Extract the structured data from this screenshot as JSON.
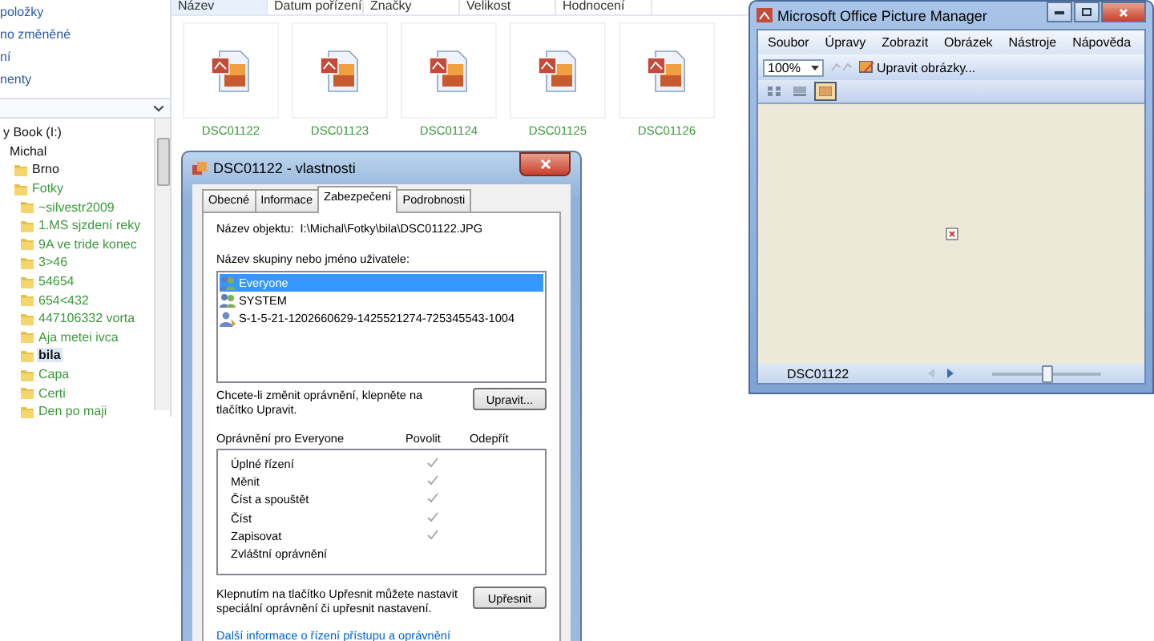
{
  "explorer": {
    "nav_links": [
      "položky",
      "no změněné",
      "ní",
      "nenty"
    ],
    "tree": [
      {
        "label": "y Book (I:)",
        "encrypted": false,
        "selected": false,
        "children": [
          {
            "label": "Michal",
            "encrypted": false,
            "selected": false,
            "children": [
              {
                "label": "Brno",
                "encrypted": false,
                "selected": false
              },
              {
                "label": "Fotky",
                "encrypted": true,
                "selected": false,
                "children": [
                  {
                    "label": "~silvestr2009",
                    "encrypted": true,
                    "selected": false
                  },
                  {
                    "label": "1.MS sjzdení  reky",
                    "encrypted": true,
                    "selected": false
                  },
                  {
                    "label": "9A ve tride konec",
                    "encrypted": true,
                    "selected": false
                  },
                  {
                    "label": "3>46",
                    "encrypted": true,
                    "selected": false
                  },
                  {
                    "label": "54654",
                    "encrypted": true,
                    "selected": false
                  },
                  {
                    "label": "654<432",
                    "encrypted": true,
                    "selected": false
                  },
                  {
                    "label": "447106332 vorta",
                    "encrypted": true,
                    "selected": false
                  },
                  {
                    "label": "Aja metei ivca",
                    "encrypted": true,
                    "selected": false
                  },
                  {
                    "label": "bila",
                    "encrypted": false,
                    "selected": true
                  },
                  {
                    "label": "Capa",
                    "encrypted": true,
                    "selected": false
                  },
                  {
                    "label": "Certi",
                    "encrypted": true,
                    "selected": false
                  },
                  {
                    "label": "Den po maji",
                    "encrypted": true,
                    "selected": false
                  }
                ]
              }
            ]
          }
        ]
      }
    ],
    "columns": [
      {
        "label": "Název",
        "selected": true
      },
      {
        "label": "Datum pořízení",
        "selected": false
      },
      {
        "label": "Značky",
        "selected": false
      },
      {
        "label": "Velikost",
        "selected": false
      },
      {
        "label": "Hodnocení",
        "selected": false
      }
    ],
    "files": [
      {
        "name": "DSC01122",
        "encrypted": true
      },
      {
        "name": "DSC01123",
        "encrypted": true
      },
      {
        "name": "DSC01124",
        "encrypted": true
      },
      {
        "name": "DSC01125",
        "encrypted": true
      },
      {
        "name": "DSC01126",
        "encrypted": true
      }
    ]
  },
  "properties_dialog": {
    "title": "DSC01122 - vlastnosti",
    "tabs": [
      {
        "label": "Obecné",
        "selected": false
      },
      {
        "label": "Informace",
        "selected": false
      },
      {
        "label": "Zabezpečení",
        "selected": true
      },
      {
        "label": "Podrobnosti",
        "selected": false
      }
    ],
    "object_label": "Název objektu:",
    "object_path": "I:\\Michal\\Fotky\\bila\\DSC01122.JPG",
    "users_label": "Název skupiny nebo jméno uživatele:",
    "users": [
      {
        "name": "Everyone",
        "kind": "group",
        "selected": true
      },
      {
        "name": "SYSTEM",
        "kind": "group",
        "selected": false
      },
      {
        "name": "S-1-5-21-1202660629-1425521274-725345543-1004",
        "kind": "user",
        "selected": false
      }
    ],
    "edit_note": "Chcete-li změnit oprávnění, klepněte na tlačítko Upravit.",
    "edit_button": "Upravit...",
    "permissions_header": "Oprávnění pro Everyone",
    "allow_header": "Povolit",
    "deny_header": "Odepřít",
    "permissions": [
      {
        "name": "Úplné řízení",
        "allow": true,
        "deny": false
      },
      {
        "name": "Měnit",
        "allow": true,
        "deny": false
      },
      {
        "name": "Číst a spouštět",
        "allow": true,
        "deny": false
      },
      {
        "name": "Číst",
        "allow": true,
        "deny": false
      },
      {
        "name": "Zapisovat",
        "allow": true,
        "deny": false
      },
      {
        "name": "Zvláštní oprávnění",
        "allow": false,
        "deny": false
      }
    ],
    "advanced_note": "Klepnutím na tlačítko Upřesnit můžete nastavit speciální oprávnění či upřesnit nastavení.",
    "advanced_button": "Upřesnit",
    "help_link": "Další informace o řízení přístupu a oprávnění"
  },
  "picture_manager": {
    "title": "Microsoft Office Picture Manager",
    "menu": [
      "Soubor",
      "Úpravy",
      "Zobrazit",
      "Obrázek",
      "Nástroje",
      "Nápověda"
    ],
    "zoom": "100%",
    "edit_pictures": "Upravit obrázky...",
    "views": [
      {
        "kind": "thumbnails",
        "selected": false
      },
      {
        "kind": "filmstrip",
        "selected": false
      },
      {
        "kind": "single",
        "selected": true
      }
    ],
    "status_file": "DSC01122",
    "zoom_slider": {
      "level": 0.5
    }
  }
}
